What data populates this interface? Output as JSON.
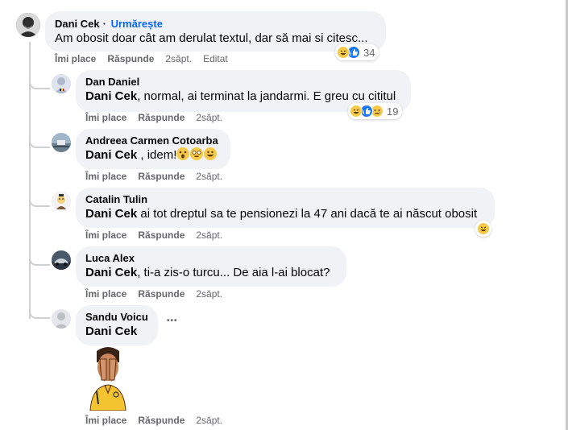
{
  "actions": {
    "like": "Îmi place",
    "reply": "Răspunde",
    "edited": "Editat"
  },
  "main_comment": {
    "author": "Dani Cek",
    "follow_label": "Urmărește",
    "text": "Am obosit doar cât am derulat textul, dar să mai si citesc...",
    "time": "2săpt.",
    "reaction_count": "34",
    "reaction_icons": [
      "haha-icon",
      "like-icon"
    ]
  },
  "replies": [
    {
      "author": "Dan Daniel",
      "mention": "Dani Cek",
      "text": ", normal, ai terminat la jandarmi. E greu cu cititul",
      "time": "2săpt.",
      "reaction_count": "19",
      "reaction_icons": [
        "haha-icon",
        "like-icon",
        "sad-icon"
      ]
    },
    {
      "author": "Andreea Carmen Cotoarba",
      "mention": "Dani Cek",
      "text": " , idem!",
      "emojis": [
        "fearful-emoji",
        "flushed-emoji",
        "grin-emoji"
      ],
      "time": "2săpt."
    },
    {
      "author": "Catalin Tulin",
      "mention": "Dani Cek",
      "text": " ai tot dreptul sa te pensionezi la 47 ani dacă te ai născut obosit",
      "time": "2săpt.",
      "reaction_icons": [
        "haha-icon"
      ]
    },
    {
      "author": "Luca Alex",
      "mention": "Dani Cek",
      "text": ", ti-a zis-o turcu... De aia l-ai blocat?",
      "time": "2săpt."
    },
    {
      "author": "Sandu Voicu",
      "mention": "Dani Cek",
      "text": "",
      "time": "2săpt.",
      "more_label": "•••",
      "sticker": "facepalm-sticker"
    }
  ],
  "colors": {
    "link": "#0866ff",
    "bubble": "#f0f2f5",
    "meta": "#65676b",
    "like": "#1877f2",
    "haha": "#f7c948"
  }
}
